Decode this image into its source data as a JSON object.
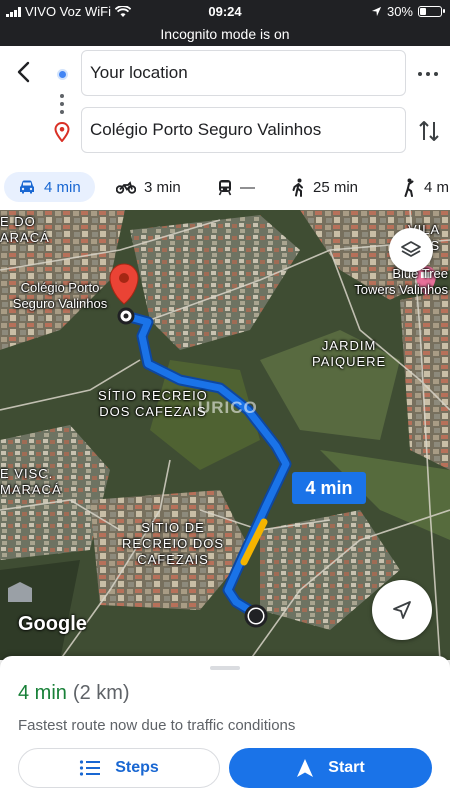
{
  "status_bar": {
    "carrier": "VIVO Voz WiFi",
    "time": "09:24",
    "battery": "30%",
    "battery_level": 0.3,
    "icons": [
      "signal-icon",
      "wifi-icon",
      "location-arrow-icon",
      "battery-icon"
    ]
  },
  "incognito_text": "Incognito mode is on",
  "directions": {
    "origin": "Your location",
    "destination": "Colégio Porto Seguro Valinhos",
    "icons": [
      "back-arrow-icon",
      "more-icon",
      "swap-icon"
    ]
  },
  "modes": [
    {
      "name": "drive",
      "icon": "car-icon",
      "label": "4 min",
      "active": true
    },
    {
      "name": "motorcycle",
      "icon": "motorcycle-icon",
      "label": "3 min",
      "active": false
    },
    {
      "name": "transit",
      "icon": "train-icon",
      "label": "—",
      "active": false
    },
    {
      "name": "walk",
      "icon": "walking-icon",
      "label": "25 min",
      "active": false
    },
    {
      "name": "ride",
      "icon": "ride-hailing-icon",
      "label": "4 m",
      "active": false
    }
  ],
  "map": {
    "labels": {
      "ede_do_aracaju": "E DO\nARACÁ",
      "destination_name": "Colégio Porto\nSeguro Valinhos",
      "vila": "VILA\nS",
      "blue_tree": "Blue Tree\nTowers Valinhos",
      "jardim_paiquere": "JARDIM\nPAIQUERE",
      "sitio_recreio_1": "SÍTIO RECREIO\nDOS CAFEZAIS",
      "e_visc": "E VISC.\nMARACÁ",
      "sitio_recreio_2": "SÍTIO DE\nRECREIO DOS\nCAFEZAIS"
    },
    "duration_badge": "4 min",
    "watermark": "URICO",
    "logo": "Google",
    "route_color": "#1a73e8",
    "traffic_slow_color": "#f4b400"
  },
  "bottom_sheet": {
    "duration": "4 min",
    "distance": "(2 km)",
    "note": "Fastest route now due to traffic conditions",
    "steps_label": "Steps",
    "start_label": "Start"
  }
}
